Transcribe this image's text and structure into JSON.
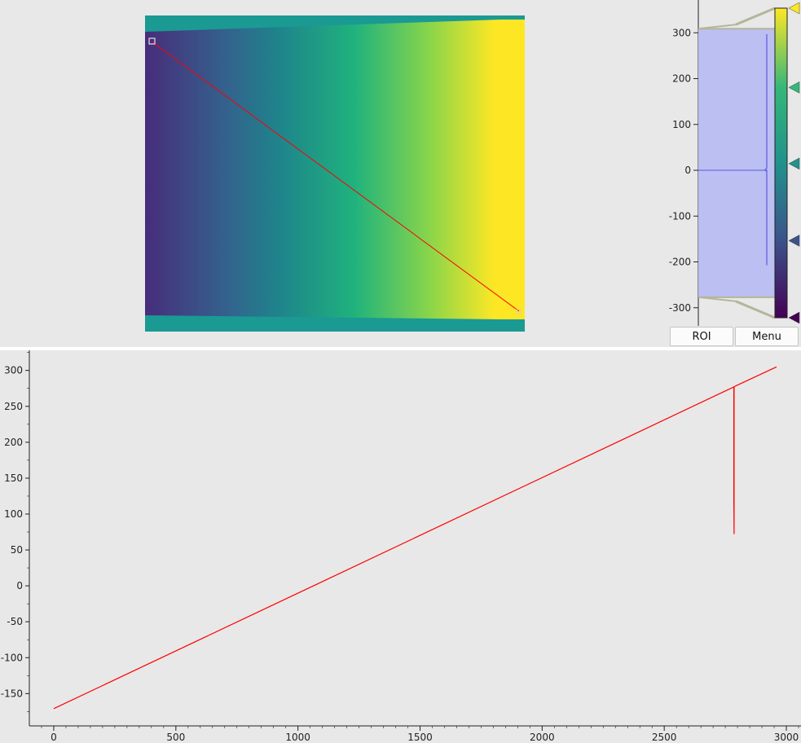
{
  "histogram": {
    "axis_ticks": [
      "300",
      "200",
      "100",
      "0",
      "-100",
      "-200",
      "-300"
    ],
    "axis_tick_values": [
      300,
      200,
      100,
      0,
      -100,
      -200,
      -300
    ],
    "level_max": 309,
    "level_min": -277,
    "gradient_stops": [
      {
        "value": 354,
        "color": "#fde725"
      },
      {
        "value": 180,
        "color": "#35b779"
      },
      {
        "value": 13,
        "color": "#21918c"
      },
      {
        "value": -156,
        "color": "#3b528b"
      },
      {
        "value": -325,
        "color": "#440154"
      }
    ]
  },
  "buttons": {
    "roi_label": "ROI",
    "menu_label": "Menu"
  },
  "colors": {
    "accent": "#ff0000",
    "background": "#e8e8e8",
    "histogram_region": "#bcbff2"
  },
  "chart_data": {
    "type": "line",
    "x_ticks": [
      "0",
      "500",
      "1000",
      "1500",
      "2000",
      "2500",
      "3000"
    ],
    "x_tick_values": [
      0,
      500,
      1000,
      1500,
      2000,
      2500,
      3000
    ],
    "y_ticks": [
      "300",
      "250",
      "200",
      "150",
      "100",
      "50",
      "0",
      "-50",
      "-100",
      "-150"
    ],
    "y_tick_values": [
      300,
      250,
      200,
      150,
      100,
      50,
      0,
      -50,
      -100,
      -150
    ],
    "xlim": [
      -100,
      3060
    ],
    "ylim": [
      -195,
      328
    ],
    "series": [
      {
        "color": "#ff0000",
        "x": [
          0,
          2785,
          2785,
          2786,
          2786,
          2790,
          2790,
          2960
        ],
        "y": [
          -171,
          277,
          117,
          72,
          277,
          278,
          278,
          305
        ]
      }
    ]
  }
}
